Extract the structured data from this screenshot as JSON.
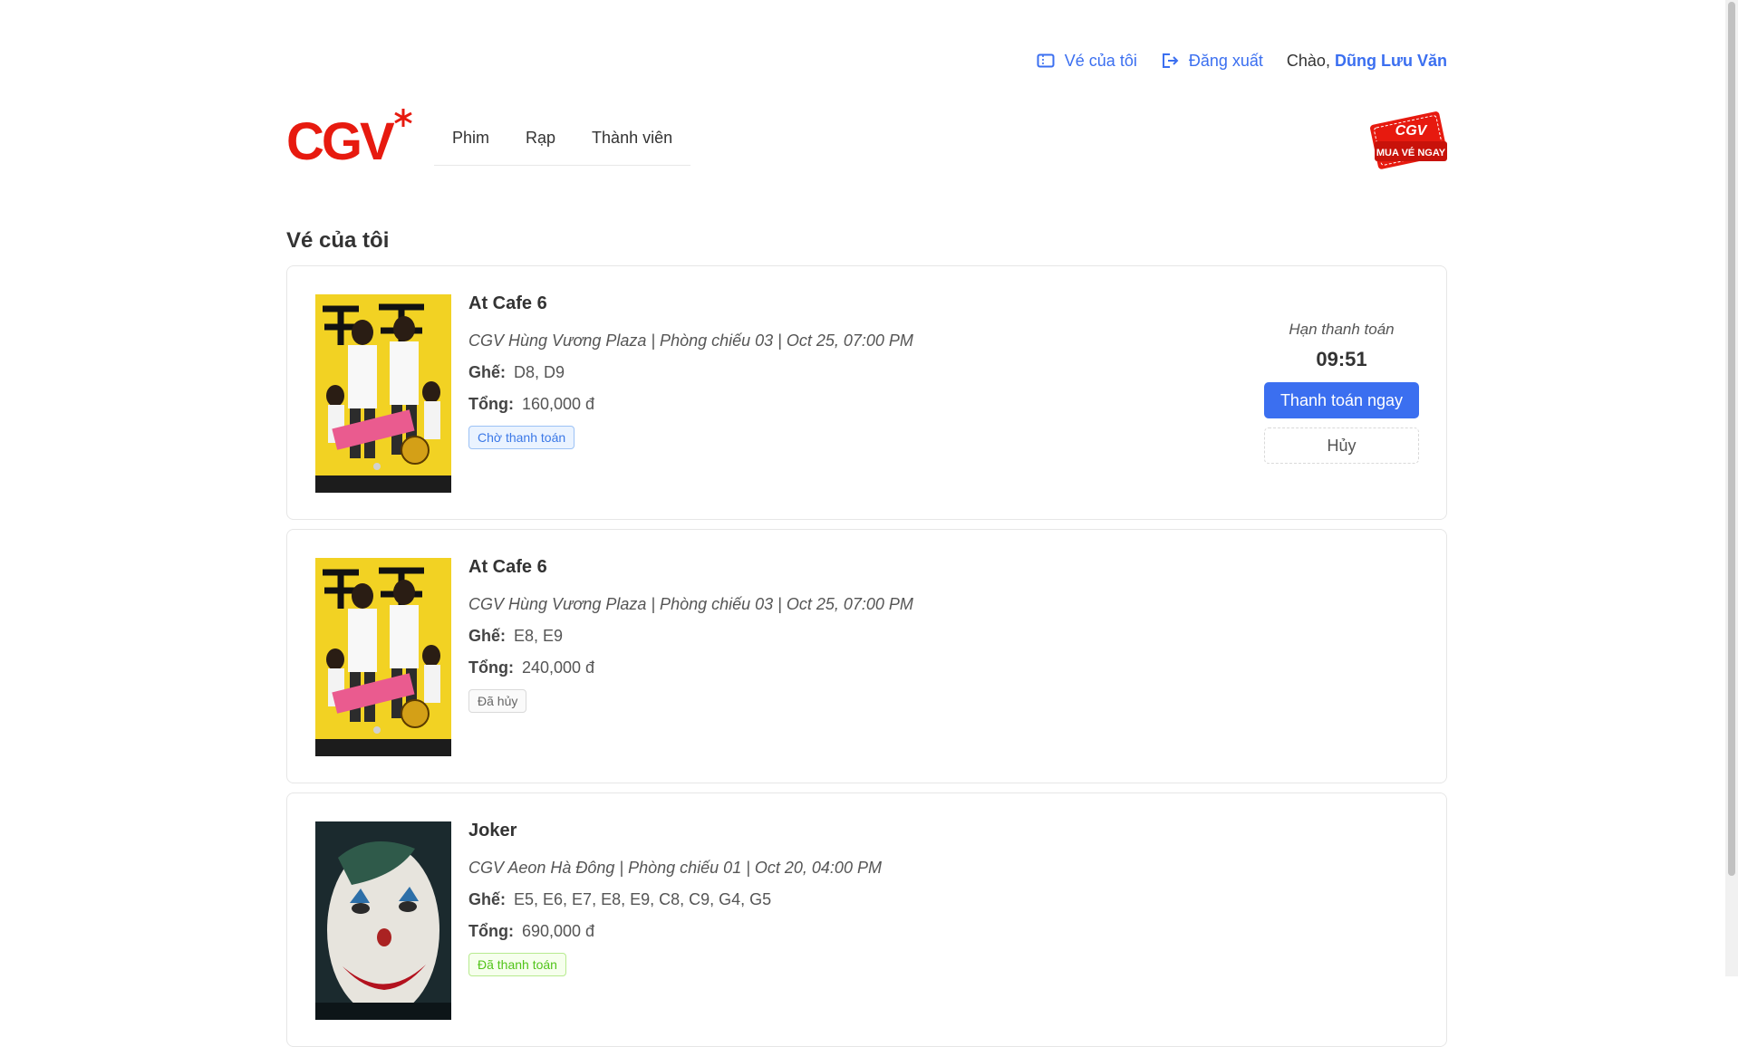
{
  "topbar": {
    "my_tickets": "Vé của tôi",
    "logout": "Đăng xuất",
    "greeting": "Chào,",
    "user_name": "Dũng Lưu Văn"
  },
  "header": {
    "logo_text": "CGV",
    "nav": [
      "Phim",
      "Rạp",
      "Thành viên"
    ],
    "buy_ticket_brand": "CGV",
    "buy_ticket_label": "MUA VÉ NGAY"
  },
  "page_title": "Vé của tôi",
  "labels": {
    "seats": "Ghế:",
    "total": "Tổng:"
  },
  "tickets": [
    {
      "title": "At Cafe 6",
      "meta": "CGV Hùng Vương Plaza | Phòng chiếu 03 | Oct 25, 07:00 PM",
      "seats": "D8, D9",
      "total": "160,000 đ",
      "status": "Chờ thanh toán",
      "payment": {
        "deadline_label": "Hạn thanh toán",
        "countdown": "09:51",
        "pay_button": "Thanh toán ngay",
        "cancel_button": "Hủy"
      }
    },
    {
      "title": "At Cafe 6",
      "meta": "CGV Hùng Vương Plaza | Phòng chiếu 03 | Oct 25, 07:00 PM",
      "seats": "E8, E9",
      "total": "240,000 đ",
      "status": "Đã hủy"
    },
    {
      "title": "Joker",
      "meta": "CGV Aeon Hà Đông | Phòng chiếu 01 | Oct 20, 04:00 PM",
      "seats": "E5, E6, E7, E8, E9, C8, C9, G4, G5",
      "total": "690,000 đ",
      "status": "Đã thanh toán"
    }
  ],
  "colors": {
    "brand_red": "#e71a0f",
    "link_blue": "#3b6ff0",
    "pending": "#3b78e7",
    "paid": "#52c41a"
  }
}
